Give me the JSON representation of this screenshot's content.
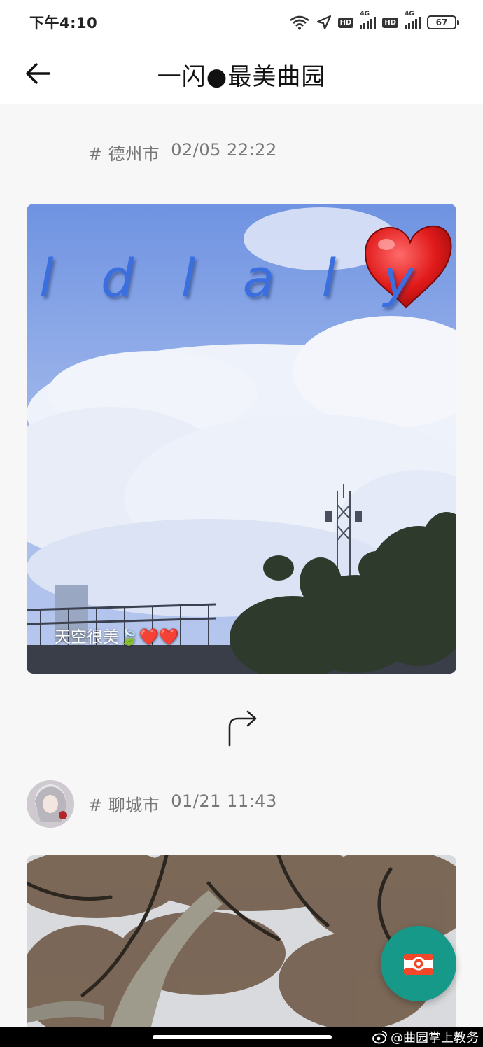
{
  "status_bar": {
    "time": "下午4:10",
    "network_1": "4G",
    "network_2": "4G",
    "hd_1": "HD",
    "hd_2": "HD",
    "battery": "67"
  },
  "header": {
    "title": "一闪●最美曲园"
  },
  "posts": [
    {
      "location": "# 德州市",
      "timestamp": "02/05 22:22",
      "overlay_text": "l d l a l y",
      "caption": "天空很美🍃❤️❤️"
    },
    {
      "location": "# 聊城市",
      "timestamp": "01/21 11:43"
    }
  ],
  "watermark": "@曲园掌上教务",
  "colors": {
    "fab": "#17998a",
    "sky": "#7a9ee8",
    "overlay_text": "#3b6fe0"
  },
  "icons": {
    "back": "arrow-left-icon",
    "share": "share-arrow-icon",
    "fab": "camera-icon",
    "heart": "heart-icon"
  }
}
